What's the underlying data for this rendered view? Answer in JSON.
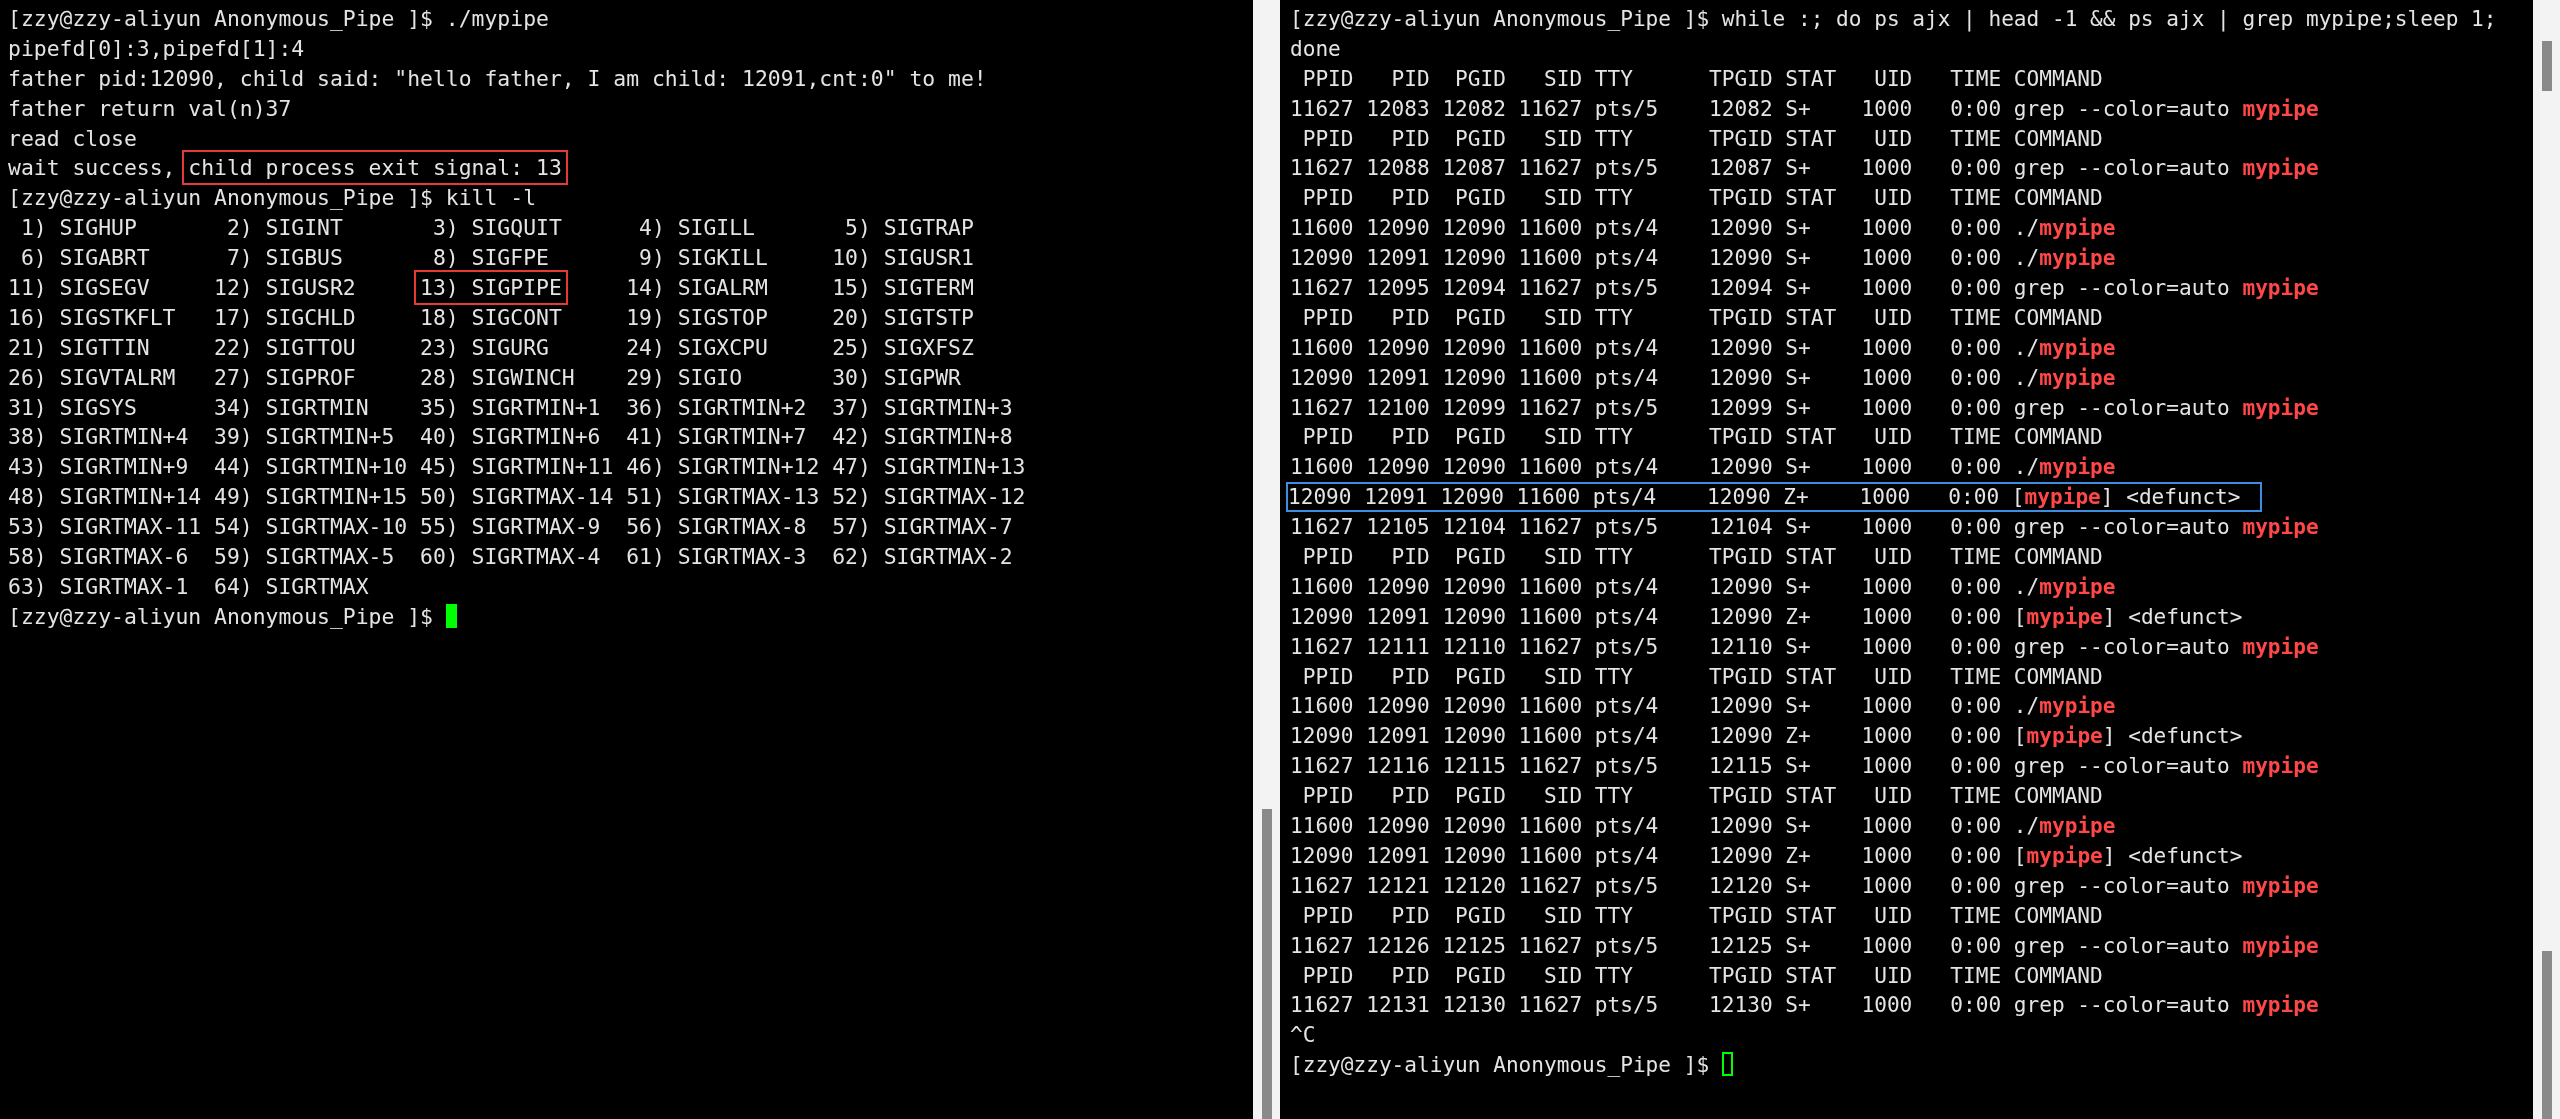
{
  "terminals": [
    {
      "lines": [
        {
          "segments": [
            {
              "kind": "text",
              "text": "[zzy@zzy-aliyun Anonymous_Pipe ]$ ./mypipe"
            }
          ]
        },
        {
          "segments": [
            {
              "kind": "text",
              "text": "pipefd[0]:3,pipefd[1]:4"
            }
          ]
        },
        {
          "segments": [
            {
              "kind": "text",
              "text": "father pid:12090, child said: \"hello father, I am child: 12091,cnt:0\" to me!"
            }
          ]
        },
        {
          "segments": [
            {
              "kind": "text",
              "text": "father return val(n)37"
            }
          ]
        },
        {
          "segments": [
            {
              "kind": "text",
              "text": "read close"
            }
          ]
        },
        {
          "segments": [
            {
              "kind": "text",
              "text": "wait success, "
            },
            {
              "kind": "text",
              "text": "child process exit signal: 13",
              "color": "#e53935"
            }
          ]
        },
        {
          "segments": [
            {
              "kind": "text",
              "text": "[zzy@zzy-aliyun Anonymous_Pipe ]$ kill -l"
            }
          ]
        },
        {
          "segments": [
            {
              "kind": "text",
              "text": " 1) SIGHUP       2) SIGINT       3) SIGQUIT      4) SIGILL       5) SIGTRAP"
            }
          ]
        },
        {
          "segments": [
            {
              "kind": "text",
              "text": " 6) SIGABRT      7) SIGBUS       8) SIGFPE       9) SIGKILL     10) SIGUSR1"
            }
          ]
        },
        {
          "segments": [
            {
              "kind": "text",
              "text": "11) SIGSEGV     12) SIGUSR2     "
            },
            {
              "kind": "text",
              "text": "13) SIGPIPE",
              "color": "#e53935"
            },
            {
              "kind": "text",
              "text": "     14) SIGALRM     15) SIGTERM"
            }
          ]
        },
        {
          "segments": [
            {
              "kind": "text",
              "text": "16) SIGSTKFLT   17) SIGCHLD     18) SIGCONT     19) SIGSTOP     20) SIGTSTP"
            }
          ]
        },
        {
          "segments": [
            {
              "kind": "text",
              "text": "21) SIGTTIN     22) SIGTTOU     23) SIGURG      24) SIGXCPU     25) SIGXFSZ"
            }
          ]
        },
        {
          "segments": [
            {
              "kind": "text",
              "text": "26) SIGVTALRM   27) SIGPROF     28) SIGWINCH    29) SIGIO       30) SIGPWR"
            }
          ]
        },
        {
          "segments": [
            {
              "kind": "text",
              "text": "31) SIGSYS      34) SIGRTMIN    35) SIGRTMIN+1  36) SIGRTMIN+2  37) SIGRTMIN+3"
            }
          ]
        },
        {
          "segments": [
            {
              "kind": "text",
              "text": "38) SIGRTMIN+4  39) SIGRTMIN+5  40) SIGRTMIN+6  41) SIGRTMIN+7  42) SIGRTMIN+8"
            }
          ]
        },
        {
          "segments": [
            {
              "kind": "text",
              "text": "43) SIGRTMIN+9  44) SIGRTMIN+10 45) SIGRTMIN+11 46) SIGRTMIN+12 47) SIGRTMIN+13"
            }
          ]
        },
        {
          "segments": [
            {
              "kind": "text",
              "text": "48) SIGRTMIN+14 49) SIGRTMIN+15 50) SIGRTMAX-14 51) SIGRTMAX-13 52) SIGRTMAX-12"
            }
          ]
        },
        {
          "segments": [
            {
              "kind": "text",
              "text": "53) SIGRTMAX-11 54) SIGRTMAX-10 55) SIGRTMAX-9  56) SIGRTMAX-8  57) SIGRTMAX-7"
            }
          ]
        },
        {
          "segments": [
            {
              "kind": "text",
              "text": "58) SIGRTMAX-6  59) SIGRTMAX-5  60) SIGRTMAX-4  61) SIGRTMAX-3  62) SIGRTMAX-2"
            }
          ]
        },
        {
          "segments": [
            {
              "kind": "text",
              "text": "63) SIGRTMAX-1  64) SIGRTMAX"
            }
          ]
        },
        {
          "segments": [
            {
              "kind": "text",
              "text": "[zzy@zzy-aliyun Anonymous_Pipe ]$ "
            },
            {
              "kind": "cursor",
              "focused": true
            }
          ]
        }
      ]
    },
    {
      "lines": [
        {
          "segments": [
            {
              "kind": "text",
              "text": "[zzy@zzy-aliyun Anonymous_Pipe ]$ while :; do ps ajx | head -1 && ps ajx | grep mypipe;sleep 1;"
            }
          ]
        },
        {
          "segments": [
            {
              "kind": "text",
              "text": "done"
            }
          ]
        },
        {
          "segments": [
            {
              "kind": "text",
              "text": " PPID   PID  PGID   SID TTY      TPGID STAT   UID   TIME COMMAND"
            }
          ]
        },
        {
          "segments": [
            {
              "kind": "text",
              "text": "11627 12083 12082 11627 pts/5    12082 S+    1000   0:00 grep --color=auto "
            },
            {
              "kind": "match",
              "text": "mypipe"
            }
          ]
        },
        {
          "segments": [
            {
              "kind": "text",
              "text": " PPID   PID  PGID   SID TTY      TPGID STAT   UID   TIME COMMAND"
            }
          ]
        },
        {
          "segments": [
            {
              "kind": "text",
              "text": "11627 12088 12087 11627 pts/5    12087 S+    1000   0:00 grep --color=auto "
            },
            {
              "kind": "match",
              "text": "mypipe"
            }
          ]
        },
        {
          "segments": [
            {
              "kind": "text",
              "text": " PPID   PID  PGID   SID TTY      TPGID STAT   UID   TIME COMMAND"
            }
          ]
        },
        {
          "segments": [
            {
              "kind": "text",
              "text": "11600 12090 12090 11600 pts/4    12090 S+    1000   0:00 ./"
            },
            {
              "kind": "match",
              "text": "mypipe"
            }
          ]
        },
        {
          "segments": [
            {
              "kind": "text",
              "text": "12090 12091 12090 11600 pts/4    12090 S+    1000   0:00 ./"
            },
            {
              "kind": "match",
              "text": "mypipe"
            }
          ]
        },
        {
          "segments": [
            {
              "kind": "text",
              "text": "11627 12095 12094 11627 pts/5    12094 S+    1000   0:00 grep --color=auto "
            },
            {
              "kind": "match",
              "text": "mypipe"
            }
          ]
        },
        {
          "segments": [
            {
              "kind": "text",
              "text": " PPID   PID  PGID   SID TTY      TPGID STAT   UID   TIME COMMAND"
            }
          ]
        },
        {
          "segments": [
            {
              "kind": "text",
              "text": "11600 12090 12090 11600 pts/4    12090 S+    1000   0:00 ./"
            },
            {
              "kind": "match",
              "text": "mypipe"
            }
          ]
        },
        {
          "segments": [
            {
              "kind": "text",
              "text": "12090 12091 12090 11600 pts/4    12090 S+    1000   0:00 ./"
            },
            {
              "kind": "match",
              "text": "mypipe"
            }
          ]
        },
        {
          "segments": [
            {
              "kind": "text",
              "text": "11627 12100 12099 11627 pts/5    12099 S+    1000   0:00 grep --color=auto "
            },
            {
              "kind": "match",
              "text": "mypipe"
            }
          ]
        },
        {
          "segments": [
            {
              "kind": "text",
              "text": " PPID   PID  PGID   SID TTY      TPGID STAT   UID   TIME COMMAND"
            }
          ]
        },
        {
          "segments": [
            {
              "kind": "text",
              "text": "11600 12090 12090 11600 pts/4    12090 S+    1000   0:00 ./"
            },
            {
              "kind": "match",
              "text": "mypipe"
            }
          ]
        },
        {
          "color": "#3c8fe0",
          "segments": [
            {
              "kind": "text",
              "text": "12090 12091 12090 11600 pts/4    12090 Z+    1000   0:00 ["
            },
            {
              "kind": "match",
              "text": "mypipe"
            },
            {
              "kind": "text",
              "text": "] <defunct>"
            }
          ]
        },
        {
          "segments": [
            {
              "kind": "text",
              "text": "11627 12105 12104 11627 pts/5    12104 S+    1000   0:00 grep --color=auto "
            },
            {
              "kind": "match",
              "text": "mypipe"
            }
          ]
        },
        {
          "segments": [
            {
              "kind": "text",
              "text": " PPID   PID  PGID   SID TTY      TPGID STAT   UID   TIME COMMAND"
            }
          ]
        },
        {
          "segments": [
            {
              "kind": "text",
              "text": "11600 12090 12090 11600 pts/4    12090 S+    1000   0:00 ./"
            },
            {
              "kind": "match",
              "text": "mypipe"
            }
          ]
        },
        {
          "segments": [
            {
              "kind": "text",
              "text": "12090 12091 12090 11600 pts/4    12090 Z+    1000   0:00 ["
            },
            {
              "kind": "match",
              "text": "mypipe"
            },
            {
              "kind": "text",
              "text": "] <defunct>"
            }
          ]
        },
        {
          "segments": [
            {
              "kind": "text",
              "text": "11627 12111 12110 11627 pts/5    12110 S+    1000   0:00 grep --color=auto "
            },
            {
              "kind": "match",
              "text": "mypipe"
            }
          ]
        },
        {
          "segments": [
            {
              "kind": "text",
              "text": " PPID   PID  PGID   SID TTY      TPGID STAT   UID   TIME COMMAND"
            }
          ]
        },
        {
          "segments": [
            {
              "kind": "text",
              "text": "11600 12090 12090 11600 pts/4    12090 S+    1000   0:00 ./"
            },
            {
              "kind": "match",
              "text": "mypipe"
            }
          ]
        },
        {
          "segments": [
            {
              "kind": "text",
              "text": "12090 12091 12090 11600 pts/4    12090 Z+    1000   0:00 ["
            },
            {
              "kind": "match",
              "text": "mypipe"
            },
            {
              "kind": "text",
              "text": "] <defunct>"
            }
          ]
        },
        {
          "segments": [
            {
              "kind": "text",
              "text": "11627 12116 12115 11627 pts/5    12115 S+    1000   0:00 grep --color=auto "
            },
            {
              "kind": "match",
              "text": "mypipe"
            }
          ]
        },
        {
          "segments": [
            {
              "kind": "text",
              "text": " PPID   PID  PGID   SID TTY      TPGID STAT   UID   TIME COMMAND"
            }
          ]
        },
        {
          "segments": [
            {
              "kind": "text",
              "text": "11600 12090 12090 11600 pts/4    12090 S+    1000   0:00 ./"
            },
            {
              "kind": "match",
              "text": "mypipe"
            }
          ]
        },
        {
          "segments": [
            {
              "kind": "text",
              "text": "12090 12091 12090 11600 pts/4    12090 Z+    1000   0:00 ["
            },
            {
              "kind": "match",
              "text": "mypipe"
            },
            {
              "kind": "text",
              "text": "] <defunct>"
            }
          ]
        },
        {
          "segments": [
            {
              "kind": "text",
              "text": "11627 12121 12120 11627 pts/5    12120 S+    1000   0:00 grep --color=auto "
            },
            {
              "kind": "match",
              "text": "mypipe"
            }
          ]
        },
        {
          "segments": [
            {
              "kind": "text",
              "text": " PPID   PID  PGID   SID TTY      TPGID STAT   UID   TIME COMMAND"
            }
          ]
        },
        {
          "segments": [
            {
              "kind": "text",
              "text": "11627 12126 12125 11627 pts/5    12125 S+    1000   0:00 grep --color=auto "
            },
            {
              "kind": "match",
              "text": "mypipe"
            }
          ]
        },
        {
          "segments": [
            {
              "kind": "text",
              "text": " PPID   PID  PGID   SID TTY      TPGID STAT   UID   TIME COMMAND"
            }
          ]
        },
        {
          "segments": [
            {
              "kind": "text",
              "text": "11627 12131 12130 11627 pts/5    12130 S+    1000   0:00 grep --color=auto "
            },
            {
              "kind": "match",
              "text": "mypipe"
            }
          ]
        },
        {
          "segments": [
            {
              "kind": "text",
              "text": "^C"
            }
          ]
        },
        {
          "segments": [
            {
              "kind": "text",
              "text": "[zzy@zzy-aliyun Anonymous_Pipe ]$ "
            },
            {
              "kind": "cursor",
              "focused": false
            }
          ]
        }
      ]
    }
  ]
}
